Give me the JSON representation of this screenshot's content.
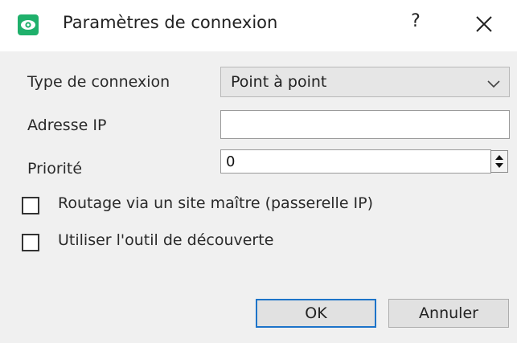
{
  "window": {
    "title": "Paramètres de connexion",
    "help_label": "?",
    "icons": {
      "app": "eye-icon",
      "close": "close-icon"
    },
    "colors": {
      "app_icon": "#1fb06b",
      "panel": "#f0f0f0",
      "default_button_border": "#1d74c9"
    }
  },
  "form": {
    "connection_type": {
      "label": "Type de connexion",
      "value": "Point à point",
      "icon": "chevron-down-icon"
    },
    "ip_address": {
      "label": "Adresse IP",
      "value": ""
    },
    "priority": {
      "label": "Priorité",
      "value": "0",
      "icon": "spin-arrows-icon"
    },
    "routing_checkbox": {
      "label": "Routage via un site maître (passerelle IP)",
      "checked": false
    },
    "discovery_checkbox": {
      "label": "Utiliser l'outil de découverte",
      "checked": false
    }
  },
  "buttons": {
    "ok": "OK",
    "cancel": "Annuler"
  }
}
